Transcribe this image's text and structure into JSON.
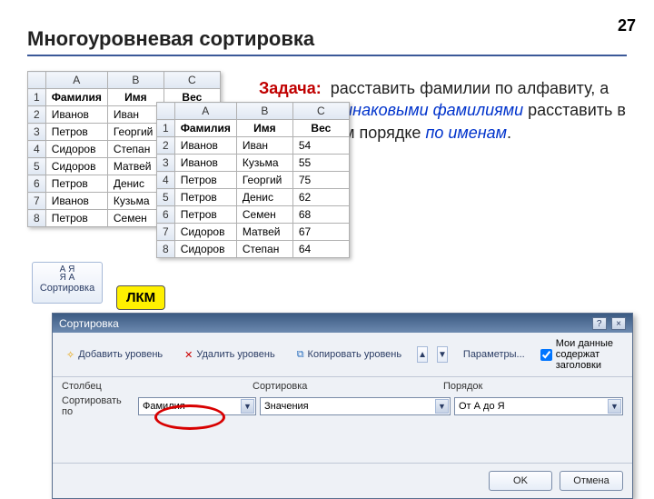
{
  "page_number": "27",
  "title": "Многоуровневая сортировка",
  "task": {
    "label": "Задача:",
    "part1": "расставить фамилии по алфавиту, а людей ",
    "em1": "с одинаковыми фамилиями",
    "part2": " расставить в алфавитном порядке ",
    "em2": "по именам",
    "part3": "."
  },
  "grid_cols": [
    "A",
    "B",
    "C"
  ],
  "grid_headers": [
    "Фамилия",
    "Имя",
    "Вес"
  ],
  "grid1_rows": [
    [
      "Иванов",
      "Иван",
      ""
    ],
    [
      "Петров",
      "Георгий",
      ""
    ],
    [
      "Сидоров",
      "Степан",
      ""
    ],
    [
      "Сидоров",
      "Матвей",
      ""
    ],
    [
      "Петров",
      "Денис",
      ""
    ],
    [
      "Иванов",
      "Кузьма",
      ""
    ],
    [
      "Петров",
      "Семен",
      ""
    ]
  ],
  "grid2_rows": [
    [
      "Иванов",
      "Иван",
      "54"
    ],
    [
      "Иванов",
      "Кузьма",
      "55"
    ],
    [
      "Петров",
      "Георгий",
      "75"
    ],
    [
      "Петров",
      "Денис",
      "62"
    ],
    [
      "Петров",
      "Семен",
      "68"
    ],
    [
      "Сидоров",
      "Матвей",
      "67"
    ],
    [
      "Сидоров",
      "Степан",
      "64"
    ]
  ],
  "sort_button_label": "Сортировка",
  "lkm_label": "ЛКМ",
  "dialog": {
    "title": "Сортировка",
    "add_level": "Добавить уровень",
    "delete_level": "Удалить уровень",
    "copy_level": "Копировать уровень",
    "params": "Параметры...",
    "has_headers_label": "Мои данные содержат заголовки",
    "has_headers_checked": true,
    "col_header_column": "Столбец",
    "col_header_sorton": "Сортировка",
    "col_header_order": "Порядок",
    "row_label": "Сортировать по",
    "column_value": "Фамилия",
    "sorton_value": "Значения",
    "order_value": "От А до Я",
    "ok": "OK",
    "cancel": "Отмена"
  }
}
